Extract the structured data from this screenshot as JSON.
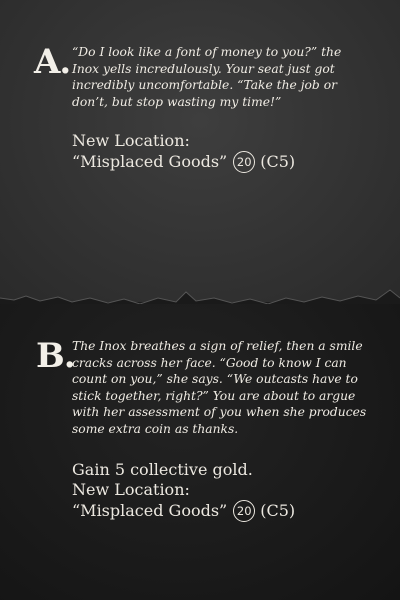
{
  "outcomes": [
    {
      "letter": "A.",
      "narrative": "“Do I look like a font of money to you?” the Inox yells incredulously. Your seat just got incredibly uncomfortable. “Take the job or don’t, but stop wasting my time!”",
      "effects": [],
      "location_label": "New Location:",
      "location_name": "“Misplaced Goods”",
      "scenario_number": "20",
      "coordinate": "(C5)"
    },
    {
      "letter": "B.",
      "narrative": "The Inox breathes a sign of relief, then a smile cracks across her face. “Good to know I can count on you,” she says. “We outcasts have to stick together, right?” You are about to argue with her assessment of you when she produces some extra coin as thanks.",
      "effects": [
        "Gain 5 collective gold."
      ],
      "location_label": "New Location:",
      "location_name": "“Misplaced Goods”",
      "scenario_number": "20",
      "coordinate": "(C5)"
    }
  ],
  "colors": {
    "panel_a": "#383838",
    "panel_b": "#1c1c1c",
    "text": "#ece8e0"
  }
}
